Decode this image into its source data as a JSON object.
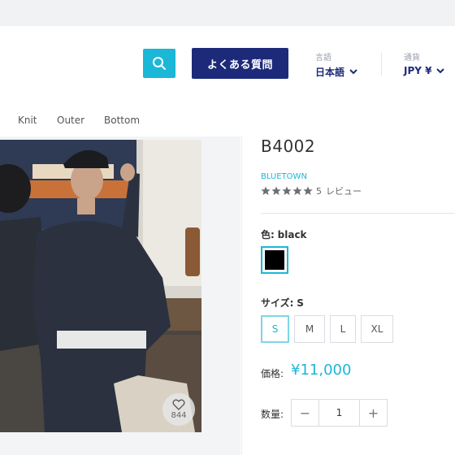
{
  "header": {
    "faq_label": "よくある質問",
    "language": {
      "caption": "言語",
      "value": "日本語"
    },
    "currency": {
      "caption": "通貨",
      "value": "JPY ¥"
    }
  },
  "nav": {
    "items": [
      "Knit",
      "Outer",
      "Bottom"
    ]
  },
  "gallery": {
    "like_count": "844"
  },
  "product": {
    "title": "B4002",
    "brand": "BLUETOWN",
    "rating": {
      "stars": 5,
      "review_count": "5",
      "review_label": "レビュー"
    },
    "color": {
      "label": "色:",
      "value": "black",
      "swatch": "#000000"
    },
    "size": {
      "label": "サイズ:",
      "value": "S",
      "options": [
        "S",
        "M",
        "L",
        "XL"
      ],
      "selected": "S"
    },
    "price": {
      "label": "価格:",
      "value": "¥11,000"
    },
    "quantity": {
      "label": "数量:",
      "value": "1",
      "minus": "−",
      "plus": "+"
    }
  },
  "colors": {
    "accent": "#1bb7d6",
    "navy": "#1d2a7a"
  }
}
